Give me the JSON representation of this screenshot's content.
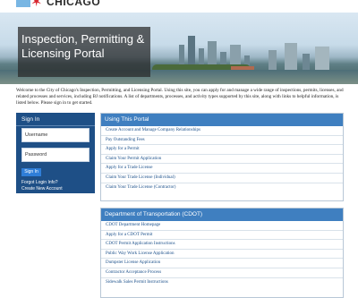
{
  "header": {
    "logo_text": "CHICAGO"
  },
  "hero": {
    "title": "Inspection, Permitting & Licensing Portal"
  },
  "intro": {
    "text": "Welcome to the City of Chicago's Inspection, Permitting, and Licensing Portal. Using this site, you can apply for and manage a wide range of inspections, permits, licenses, and related processes and services, including BJ notifications. A list of departments, processes, and activity types supported by this site, along with links to helpful information, is listed below. Please sign in to get started."
  },
  "signin": {
    "title": "Sign In",
    "username_placeholder": "Username",
    "password_placeholder": "Password",
    "button_label": "Sign In",
    "forgot_link": "Forgot Login Info?",
    "create_link": "Create New Account"
  },
  "panels": [
    {
      "title": "Using This Portal",
      "links": [
        "Create Account and Manage Company Relationships",
        "Pay Outstanding Fees",
        "Apply for a Permit",
        "Claim Your Permit Application",
        "Apply for a Trade License",
        "Claim Your Trade License (Individual)",
        "Claim Your Trade License (Contractor)"
      ]
    },
    {
      "title": "Department of Transportation (CDOT)",
      "links": [
        "CDOT Department Homepage",
        "Apply for a CDOT Permit",
        "CDOT Permit Application Instructions",
        "Public Way Work License Application",
        "Dumpster License Application",
        "Contractor Acceptance Process",
        "Sidewalk Sales Permit Instructions"
      ]
    }
  ],
  "colors": {
    "brand_blue": "#1e4f86",
    "panel_header_blue": "#3f7fc0",
    "link_blue": "#1a4f8a",
    "logo_red_star": "#d7262f",
    "logo_light_blue": "#79b6e3"
  }
}
